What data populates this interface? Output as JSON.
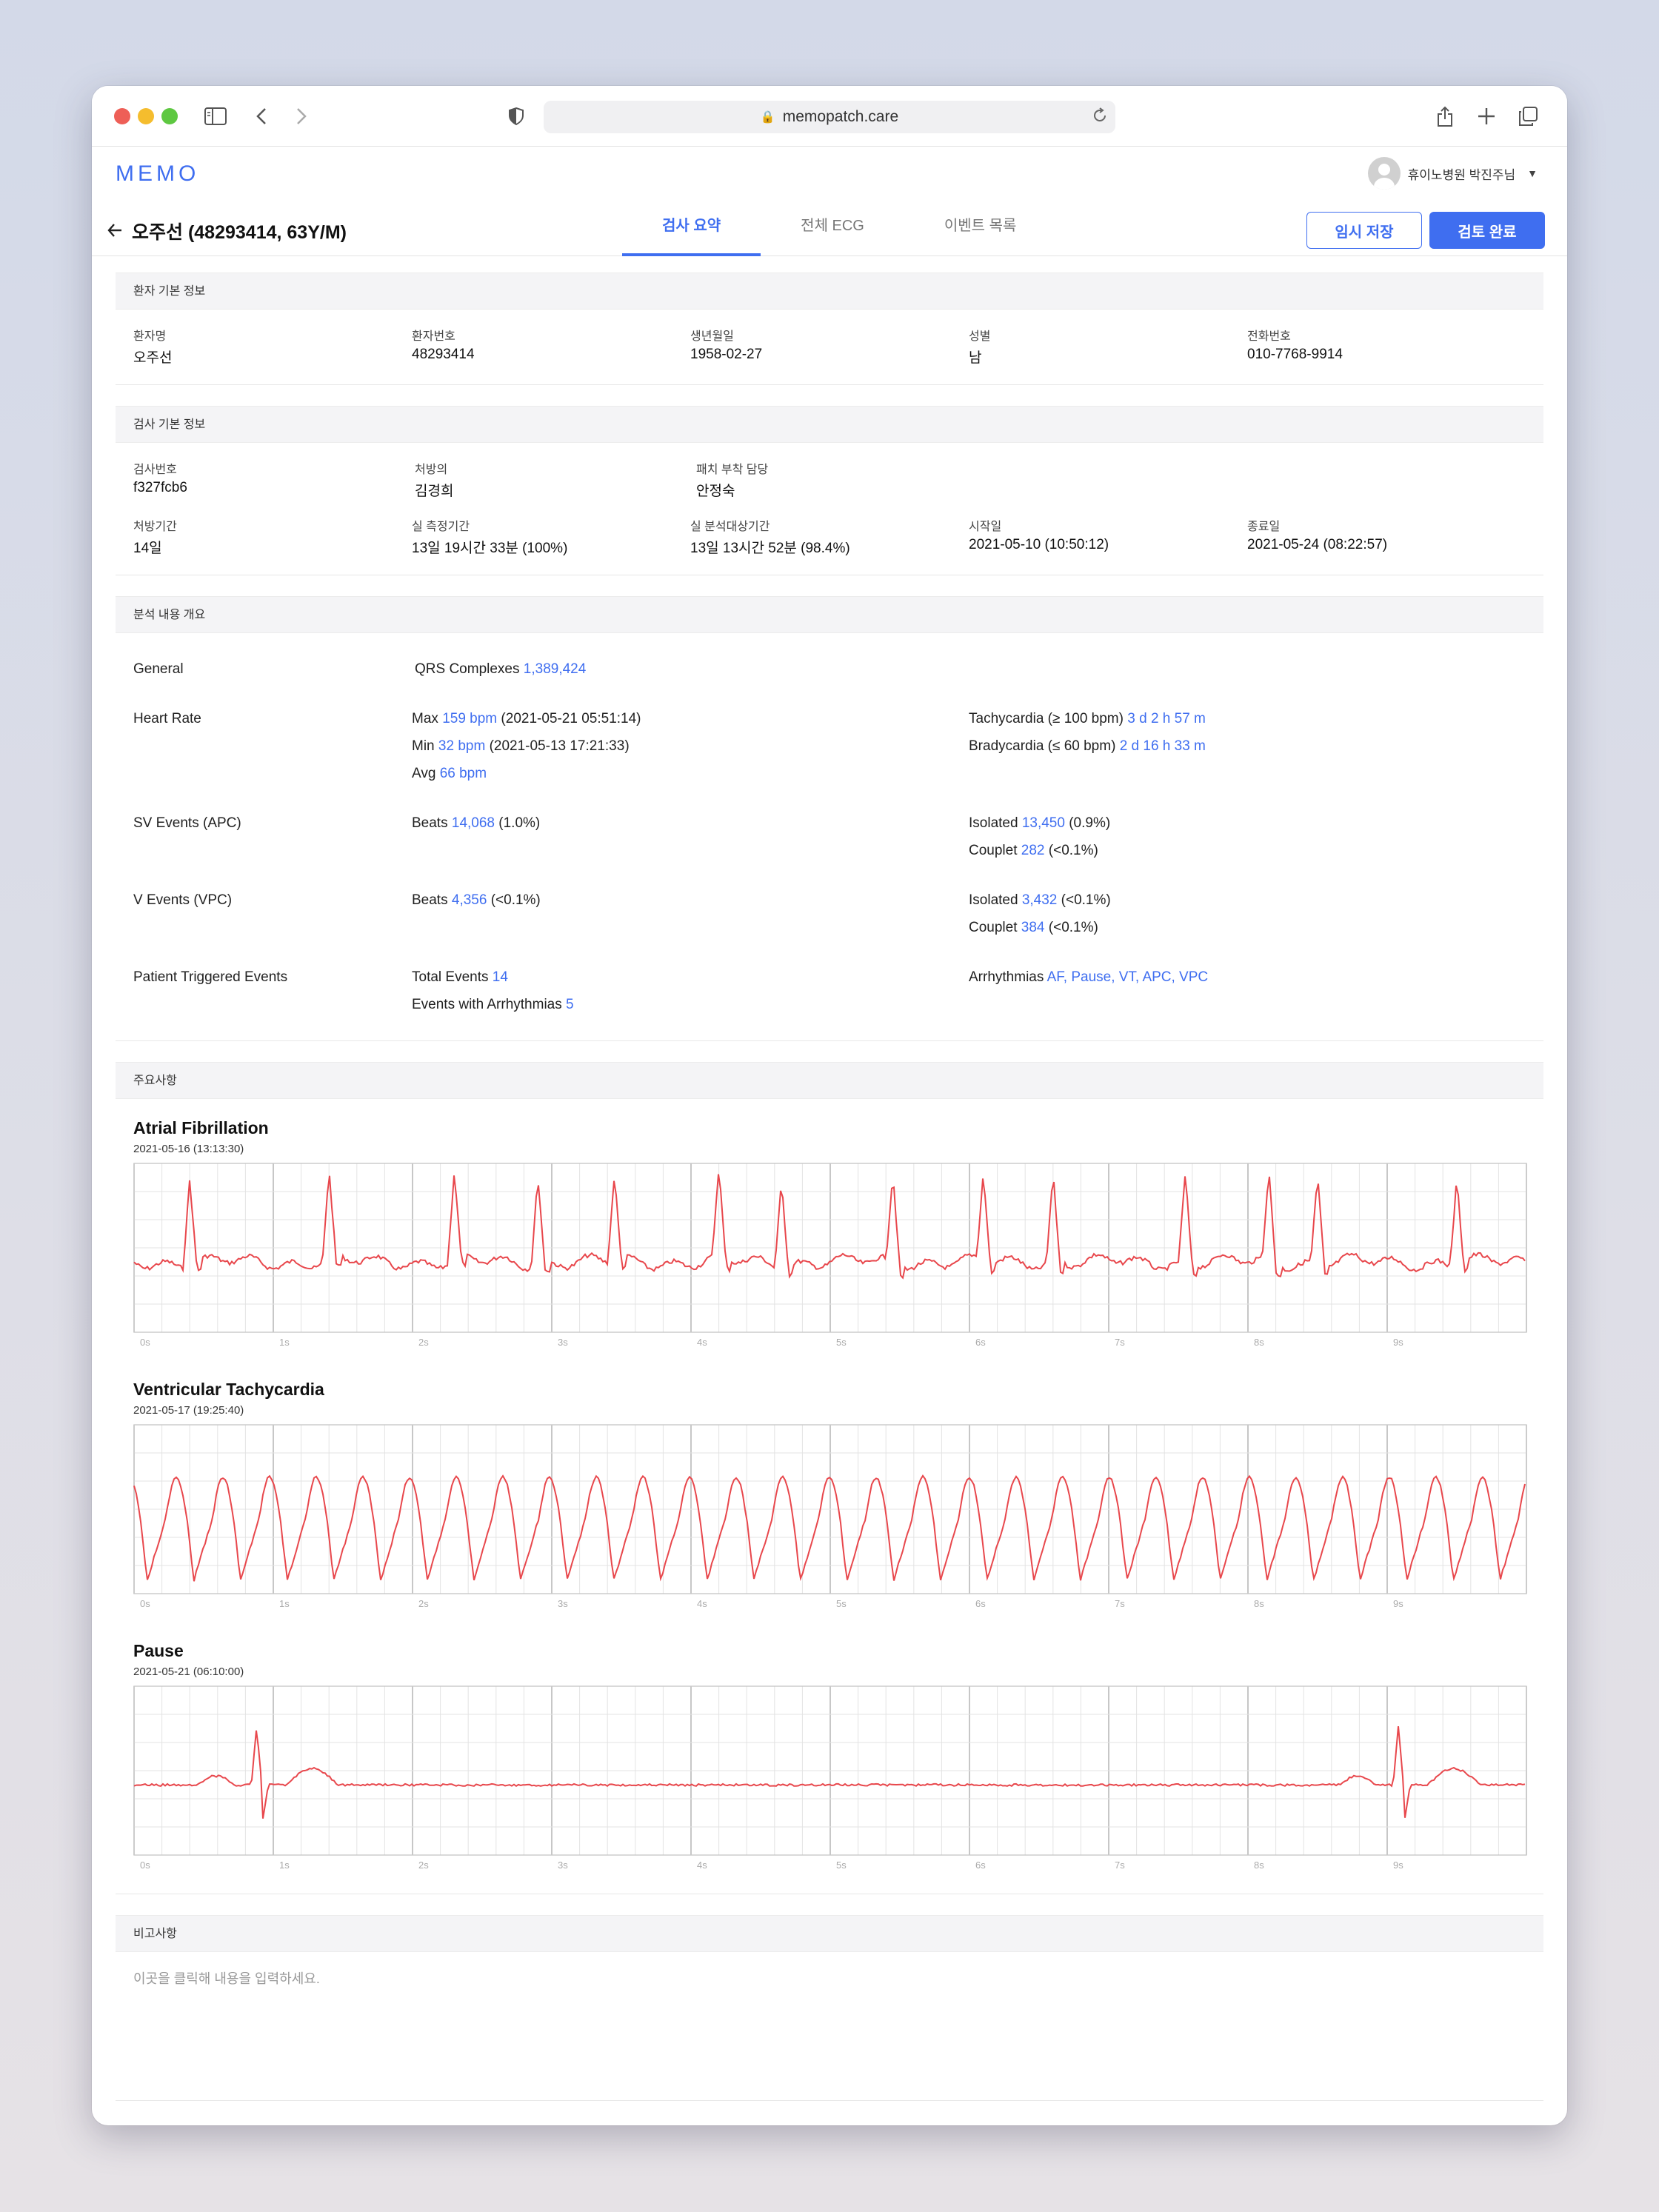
{
  "browser": {
    "url": "memopatch.care"
  },
  "app": {
    "logo": "MEMO",
    "user_name": "휴이노병원 박진주님"
  },
  "patient_header": {
    "title": "오주선 (48293414, 63Y/M)",
    "tabs": [
      {
        "label": "검사 요약",
        "active": true
      },
      {
        "label": "전체 ECG",
        "active": false
      },
      {
        "label": "이벤트 목록",
        "active": false
      }
    ],
    "save_label": "임시 저장",
    "done_label": "검토 완료"
  },
  "patient_info": {
    "header": "환자 기본 정보",
    "fields": [
      {
        "label": "환자명",
        "value": "오주선"
      },
      {
        "label": "환자번호",
        "value": "48293414"
      },
      {
        "label": "생년월일",
        "value": "1958-02-27"
      },
      {
        "label": "성별",
        "value": "남"
      },
      {
        "label": "전화번호",
        "value": "010-7768-9914"
      }
    ]
  },
  "exam_info": {
    "header": "검사 기본 정보",
    "row1": [
      {
        "label": "검사번호",
        "value": "f327fcb6"
      },
      {
        "label": "처방의",
        "value": "김경희"
      },
      {
        "label": "패치 부착 담당",
        "value": "안정숙"
      }
    ],
    "row2": [
      {
        "label": "처방기간",
        "value": "14일"
      },
      {
        "label": "실 측정기간",
        "value": "13일 19시간 33분 (100%)"
      },
      {
        "label": "실 분석대상기간",
        "value": "13일 13시간 52분 (98.4%)"
      },
      {
        "label": "시작일",
        "value": "2021-05-10 (10:50:12)"
      },
      {
        "label": "종료일",
        "value": "2021-05-24 (08:22:57)"
      }
    ]
  },
  "analysis": {
    "header": "분석 내용 개요",
    "general": {
      "label": "General",
      "qrs_label": "QRS Complexes",
      "qrs_value": "1,389,424"
    },
    "heart_rate": {
      "label": "Heart Rate",
      "max_label": "Max",
      "max_value": "159 bpm",
      "max_time": "(2021-05-21 05:51:14)",
      "min_label": "Min",
      "min_value": "32 bpm",
      "min_time": "(2021-05-13 17:21:33)",
      "avg_label": "Avg",
      "avg_value": "66 bpm",
      "tachy_label": "Tachycardia (≥ 100 bpm)",
      "tachy_value": "3 d 2 h 57 m",
      "brady_label": "Bradycardia (≤ 60 bpm)",
      "brady_value": "2 d 16 h 33 m"
    },
    "sv_events": {
      "label": "SV Events (APC)",
      "beats_label": "Beats",
      "beats_value": "14,068",
      "beats_pct": "(1.0%)",
      "isolated_label": "Isolated",
      "isolated_value": "13,450",
      "isolated_pct": "(0.9%)",
      "couplet_label": "Couplet",
      "couplet_value": "282",
      "couplet_pct": "(<0.1%)"
    },
    "v_events": {
      "label": "V Events (VPC)",
      "beats_label": "Beats",
      "beats_value": "4,356",
      "beats_pct": "(<0.1%)",
      "isolated_label": "Isolated",
      "isolated_value": "3,432",
      "isolated_pct": "(<0.1%)",
      "couplet_label": "Couplet",
      "couplet_value": "384",
      "couplet_pct": "(<0.1%)"
    },
    "triggered": {
      "label": "Patient Triggered Events",
      "total_label": "Total Events",
      "total_value": "14",
      "arr_events_label": "Events with Arrhythmias",
      "arr_events_value": "5",
      "arrhythmias_label": "Arrhythmias",
      "arrhythmias_value": "AF, Pause, VT, APC, VPC"
    }
  },
  "highlights": {
    "header": "주요사항",
    "strips": [
      {
        "title": "Atrial Fibrillation",
        "date": "2021-05-16 (13:13:30)",
        "pattern": "afib"
      },
      {
        "title": "Ventricular Tachycardia",
        "date": "2021-05-17 (19:25:40)",
        "pattern": "vt"
      },
      {
        "title": "Pause",
        "date": "2021-05-21 (06:10:00)",
        "pattern": "pause"
      }
    ],
    "time_ticks": [
      "0s",
      "1s",
      "2s",
      "3s",
      "4s",
      "5s",
      "6s",
      "7s",
      "8s",
      "9s"
    ],
    "trace_color": "#e8474c"
  },
  "notes": {
    "header": "비고사항",
    "placeholder": "이곳을 클릭해 내용을 입력하세요."
  }
}
